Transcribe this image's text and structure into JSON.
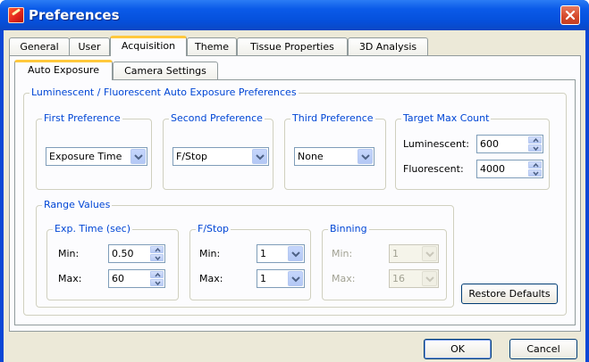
{
  "window": {
    "title": "Preferences"
  },
  "outer_tabs": [
    "General",
    "User",
    "Acquisition",
    "Theme",
    "Tissue Properties",
    "3D Analysis"
  ],
  "active_outer_tab": "Acquisition",
  "inner_tabs": [
    "Auto Exposure",
    "Camera Settings"
  ],
  "active_inner_tab": "Auto Exposure",
  "auto_exposure": {
    "group_title": "Luminescent / Fluorescent Auto Exposure Preferences",
    "first_pref": {
      "title": "First Preference",
      "value": "Exposure Time"
    },
    "second_pref": {
      "title": "Second Preference",
      "value": "F/Stop"
    },
    "third_pref": {
      "title": "Third Preference",
      "value": "None"
    },
    "target": {
      "title": "Target Max Count",
      "lum_label": "Luminescent:",
      "lum_value": "600",
      "fluo_label": "Fluorescent:",
      "fluo_value": "4000"
    },
    "range": {
      "title": "Range Values",
      "exp": {
        "title": "Exp. Time (sec)",
        "min_label": "Min:",
        "min": "0.50",
        "max_label": "Max:",
        "max": "60"
      },
      "fstop": {
        "title": "F/Stop",
        "min_label": "Min:",
        "min": "1",
        "max_label": "Max:",
        "max": "1"
      },
      "binning": {
        "title": "Binning",
        "min_label": "Min:",
        "min": "1",
        "max_label": "Max:",
        "max": "16"
      }
    },
    "restore_label": "Restore Defaults"
  },
  "footer": {
    "ok_label": "OK",
    "cancel_label": "Cancel"
  },
  "colors": {
    "titlebar": "#0a5ae8",
    "group_label": "#0046d5",
    "active_tab_accent": "#ffc83c"
  }
}
